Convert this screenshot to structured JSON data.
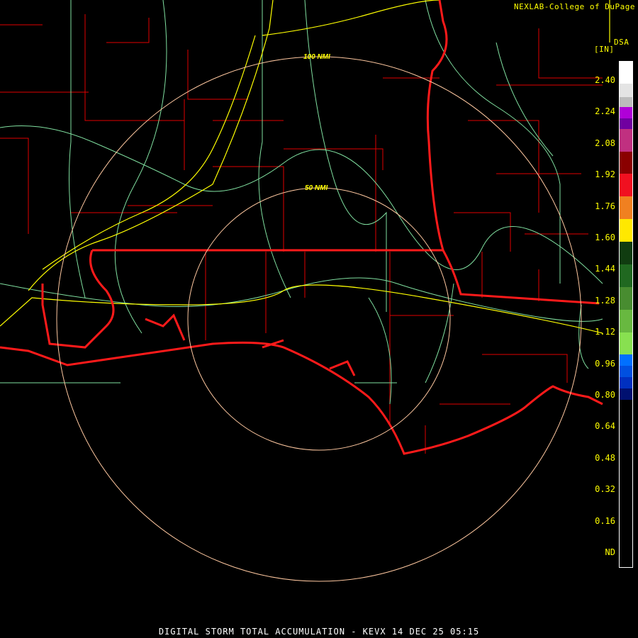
{
  "header": {
    "credit": "NEXLAB-College of DuPage",
    "product": "DSA",
    "units": "[IN]"
  },
  "caption": "DIGITAL STORM TOTAL ACCUMULATION - KEVX 14 DEC 25 05:15",
  "range_rings": [
    {
      "label": "50 NMI"
    },
    {
      "label": "100 NMI"
    }
  ],
  "legend": {
    "labels": [
      "2.40",
      "2.24",
      "2.08",
      "1.92",
      "1.76",
      "1.60",
      "1.44",
      "1.28",
      "1.12",
      "0.96",
      "0.80",
      "0.64",
      "0.48",
      "0.32",
      "0.16",
      "ND"
    ],
    "segments": [
      {
        "color": "#ffffff",
        "weight": 31
      },
      {
        "color": "#e4e4e4",
        "weight": 19
      },
      {
        "color": "#bcbcbc",
        "weight": 14
      },
      {
        "color": "#b000d8",
        "weight": 16
      },
      {
        "color": "#7000a0",
        "weight": 15
      },
      {
        "color": "#c03080",
        "weight": 32
      },
      {
        "color": "#8a0000",
        "weight": 31
      },
      {
        "color": "#f01020",
        "weight": 32
      },
      {
        "color": "#f08020",
        "weight": 32
      },
      {
        "color": "#ffe800",
        "weight": 32
      },
      {
        "color": "#103c10",
        "weight": 32
      },
      {
        "color": "#206820",
        "weight": 32
      },
      {
        "color": "#488c30",
        "weight": 32
      },
      {
        "color": "#68b840",
        "weight": 32
      },
      {
        "color": "#88e050",
        "weight": 31
      },
      {
        "color": "#0070ff",
        "weight": 16
      },
      {
        "color": "#0050e0",
        "weight": 16
      },
      {
        "color": "#0030c0",
        "weight": 16
      },
      {
        "color": "#001070",
        "weight": 16
      },
      {
        "color": "#000000",
        "weight": 236
      }
    ]
  },
  "colors": {
    "state": "#ff1a1a",
    "county": "#e00000",
    "road": "#80e0a0",
    "interstate": "#ffff00",
    "ring": "#ffc8a0"
  }
}
